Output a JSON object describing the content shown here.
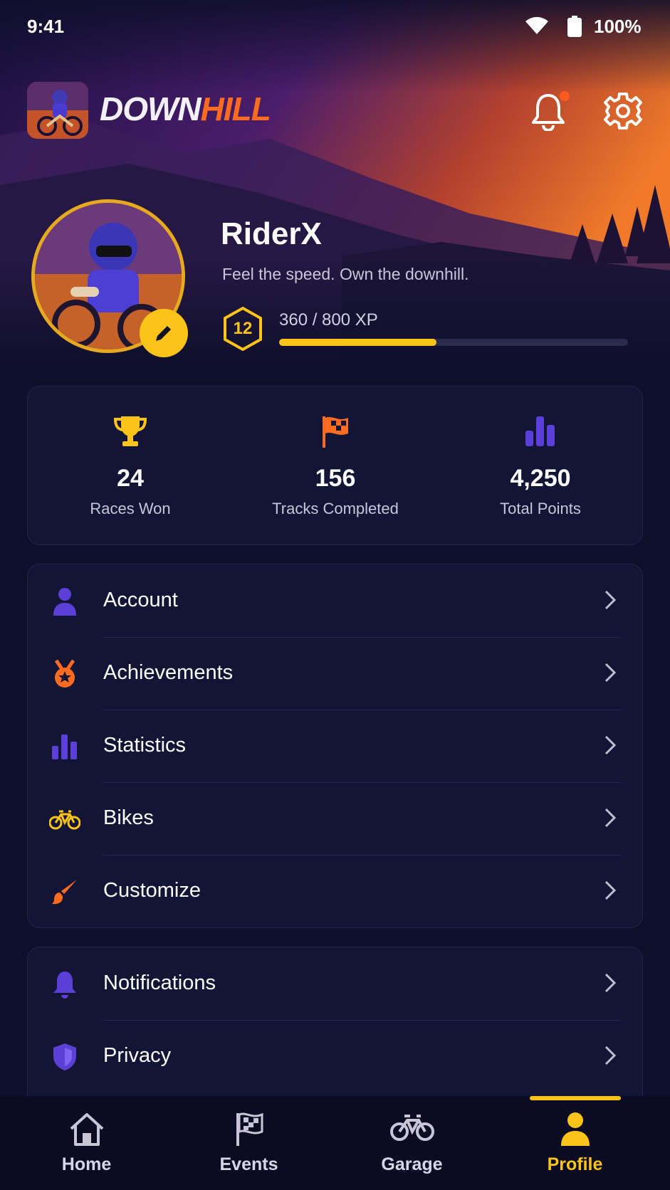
{
  "status_bar": {
    "time": "9:41",
    "battery": "100%"
  },
  "header": {
    "brand_part1": "DOWN",
    "brand_part2": "HILL"
  },
  "profile": {
    "username": "RiderX",
    "tagline": "Feel the speed. Own the downhill.",
    "level": "12",
    "xp_text": "360 / 800 XP",
    "xp_current": 360,
    "xp_max": 800
  },
  "stats": [
    {
      "icon": "trophy-icon",
      "value": "24",
      "label": "Races Won"
    },
    {
      "icon": "checkered-flag-icon",
      "value": "156",
      "label": "Tracks Completed"
    },
    {
      "icon": "bar-chart-icon",
      "value": "4,250",
      "label": "Total Points"
    }
  ],
  "menu_main": [
    {
      "icon": "person-icon",
      "label": "Account"
    },
    {
      "icon": "medal-icon",
      "label": "Achievements"
    },
    {
      "icon": "bar-chart-icon",
      "label": "Statistics"
    },
    {
      "icon": "bicycle-icon",
      "label": "Bikes"
    },
    {
      "icon": "paintbrush-icon",
      "label": "Customize"
    }
  ],
  "menu_settings": [
    {
      "icon": "bell-icon",
      "label": "Notifications"
    },
    {
      "icon": "shield-icon",
      "label": "Privacy"
    }
  ],
  "bottom_nav": [
    {
      "icon": "home-icon",
      "label": "Home"
    },
    {
      "icon": "flag-icon",
      "label": "Events"
    },
    {
      "icon": "bicycle-icon",
      "label": "Garage"
    },
    {
      "icon": "person-icon",
      "label": "Profile",
      "active": true
    }
  ],
  "colors": {
    "accent_yellow": "#fcc419",
    "accent_orange": "#ff6b1f",
    "accent_purple": "#5b3fd6",
    "background": "#0e0f2b"
  }
}
